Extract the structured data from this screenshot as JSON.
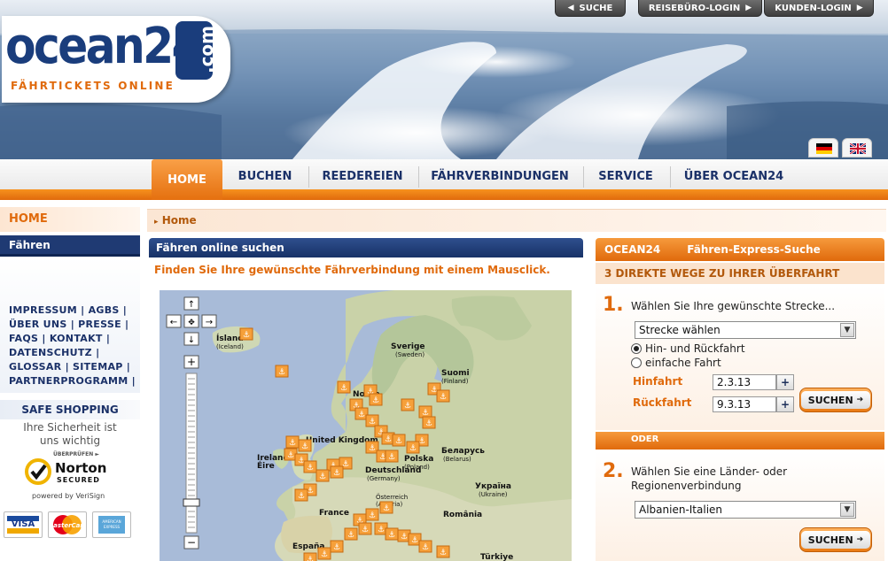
{
  "header": {
    "logo_word": "ocean24",
    "logo_tld": ".com",
    "logo_tagline": "FÄHRTICKETS ONLINE",
    "top_buttons": [
      "SUCHE",
      "REISEBÜRO-LOGIN",
      "KUNDEN-LOGIN"
    ],
    "languages": [
      "de-flag-icon",
      "uk-flag-icon"
    ]
  },
  "nav": {
    "items": [
      "HOME",
      "BUCHEN",
      "REEDEREIEN",
      "FÄHRVERBINDUNGEN",
      "SERVICE",
      "ÜBER OCEAN24"
    ],
    "active": "HOME"
  },
  "sidebar": {
    "home": "HOME",
    "section": "Fähren",
    "links": [
      [
        "IMPRESSUM",
        "AGBS"
      ],
      [
        "ÜBER UNS",
        "PRESSE"
      ],
      [
        "FAQS",
        "KONTAKT"
      ],
      [
        "DATENSCHUTZ"
      ],
      [
        "GLOSSAR",
        "SITEMAP"
      ],
      [
        "PARTNERPROGRAMM"
      ]
    ],
    "safe_title": "SAFE SHOPPING",
    "safe_sub": [
      "Ihre Sicherheit ist",
      "uns wichtig"
    ],
    "norton": {
      "top": "ÜBERPRÜFEN ►",
      "name": "Norton",
      "secured": "SECURED",
      "by": "powered by VeriSign"
    },
    "cards": [
      "VISA",
      "MasterCard",
      "AMERICAN EXPRESS"
    ]
  },
  "breadcrumb": "Home",
  "main": {
    "title": "Fähren online suchen",
    "subtitle": "Finden Sie Ihre gewünschte Fährverbindung mit einem Mausclick.",
    "map_labels": [
      {
        "name": "Ísland",
        "sub": "(Iceland)"
      },
      {
        "name": "Sverige",
        "sub": "(Sweden)"
      },
      {
        "name": "Suomi",
        "sub": "(Finland)"
      },
      {
        "name": "Norge",
        "sub": ""
      },
      {
        "name": "Беларусь",
        "sub": "(Belarus)"
      },
      {
        "name": "Polska",
        "sub": "(Poland)"
      },
      {
        "name": "Ireland",
        "sub": "Éire"
      },
      {
        "name": "United Kingdom",
        "sub": ""
      },
      {
        "name": "Deutschland",
        "sub": "(Germany)"
      },
      {
        "name": "Україна",
        "sub": "(Ukraine)"
      },
      {
        "name": "Österreich",
        "sub": "(Austria)"
      },
      {
        "name": "France",
        "sub": ""
      },
      {
        "name": "România",
        "sub": ""
      },
      {
        "name": "España",
        "sub": ""
      },
      {
        "name": "Türkiye",
        "sub": ""
      }
    ]
  },
  "express": {
    "title_brand": "OCEAN24",
    "title": "Fähren-Express-Suche",
    "subtitle": "3 DIREKTE WEGE ZU IHRER ÜBERFAHRT",
    "step1_num": "1.",
    "step1_text": "Wählen Sie Ihre gewünschte Strecke...",
    "route_select": "Strecke wählen",
    "radio_round": "Hin- und Rückfahrt",
    "radio_single": "einfache Fahrt",
    "hin_label": "Hinfahrt",
    "hin_value": "2.3.13",
    "rueck_label": "Rückfahrt",
    "rueck_value": "9.3.13",
    "search_label": "SUCHEN",
    "or_label": "ODER",
    "step2_num": "2.",
    "step2_text": "Wählen Sie eine Länder- oder Regionenverbindung",
    "region_select": "Albanien-Italien",
    "search2_label": "SUCHEN"
  },
  "colors": {
    "orange": "#e06a0c",
    "navy": "#1b3168"
  }
}
